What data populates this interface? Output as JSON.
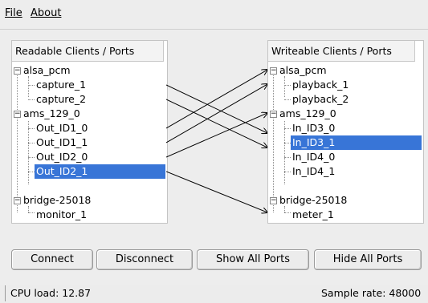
{
  "menu": {
    "file": "File",
    "about": "About"
  },
  "readable": {
    "header": "Readable Clients / Ports",
    "rows": [
      {
        "label": "alsa_pcm"
      },
      {
        "label": "capture_1"
      },
      {
        "label": "capture_2"
      },
      {
        "label": "ams_129_0"
      },
      {
        "label": "Out_ID1_0"
      },
      {
        "label": "Out_ID1_1"
      },
      {
        "label": "Out_ID2_0"
      },
      {
        "label": "Out_ID2_1"
      },
      {
        "label": "bridge-25018"
      },
      {
        "label": "monitor_1"
      }
    ]
  },
  "writeable": {
    "header": "Writeable Clients / Ports",
    "rows": [
      {
        "label": "alsa_pcm"
      },
      {
        "label": "playback_1"
      },
      {
        "label": "playback_2"
      },
      {
        "label": "ams_129_0"
      },
      {
        "label": "In_ID3_0"
      },
      {
        "label": "In_ID3_1"
      },
      {
        "label": "In_ID4_0"
      },
      {
        "label": "In_ID4_1"
      },
      {
        "label": "bridge-25018"
      },
      {
        "label": "meter_1"
      }
    ]
  },
  "buttons": {
    "connect": "Connect",
    "disconnect": "Disconnect",
    "show_all": "Show All Ports",
    "hide_all": "Hide All Ports"
  },
  "status": {
    "cpu": "CPU load: 12.87",
    "rate": "Sample rate: 48000"
  },
  "colors": {
    "selection": "#3875d7"
  }
}
